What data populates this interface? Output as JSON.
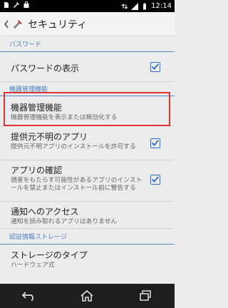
{
  "status_bar": {
    "time": "12:14",
    "left_icons": [
      "sim-card-icon",
      "tools-icon",
      "shopping-bag-icon"
    ],
    "right_icons": [
      "data-icon",
      "signal-icon",
      "battery-icon"
    ]
  },
  "action_bar": {
    "title": "セキュリティ"
  },
  "sections": {
    "password": "パスワード",
    "device_admin": "機器管理機能",
    "credential_storage": "認証情報ストレージ"
  },
  "items": {
    "show_password": {
      "title": "パスワードの表示",
      "checked": true
    },
    "device_admins": {
      "title": "機器管理機能",
      "summary": "機器管理機能を表示または無効化する"
    },
    "unknown_sources": {
      "title": "提供元不明のアプリ",
      "summary": "提供元不明アプリのインストールを許可する",
      "checked": true
    },
    "verify_apps": {
      "title": "アプリの確認",
      "summary": "損害をもたらす可能性があるアプリのインストールを禁止またはインストール前に警告する",
      "checked": true
    },
    "notification_access": {
      "title": "通知へのアクセス",
      "summary": "通知を読み取れるアプリはありません"
    },
    "storage_type": {
      "title": "ストレージのタイプ",
      "summary": "ハードウェア式"
    }
  },
  "colors": {
    "accent": "#2a6dd6",
    "section_text": "#4a7fbf",
    "highlight": "#e23333"
  }
}
